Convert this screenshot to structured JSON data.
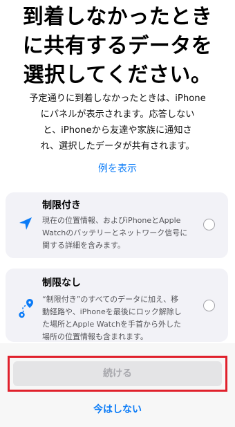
{
  "header": {
    "title_lines": [
      "到着しなかったとき",
      "に共有するデータを",
      "選択してください。"
    ]
  },
  "description_lines": [
    "予定通りに到着しなかったときは、iPhone",
    "にパネルが表示されます。応答しない",
    "と、iPhoneから友達や家族に通知さ",
    "れ、選択したデータが共有されます。"
  ],
  "example_link": "例を表示",
  "options": [
    {
      "title": "制限付き",
      "description_lines": [
        "現在の位置情報、およびiPhoneとApple",
        "Watchのバッテリーとネットワーク信号に",
        "関する詳細を含みます。"
      ],
      "icon": "location-arrow-icon",
      "selected": false
    },
    {
      "title": "制限なし",
      "description_lines": [
        "“制限付き”のすべてのデータに加え、移",
        "動経路や、iPhoneを最後にロック解除し",
        "た場所とApple Watchを手首から外した",
        "場所の位置情報も含まれます。"
      ],
      "icon": "route-icon",
      "selected": false
    }
  ],
  "footer": {
    "continue_label": "続ける",
    "not_now_label": "今はしない"
  },
  "colors": {
    "accent": "#0a7bf7",
    "highlight_outline": "#e0212c",
    "card_background": "#f2f2f7",
    "disabled_button": "#e4e4e6"
  }
}
